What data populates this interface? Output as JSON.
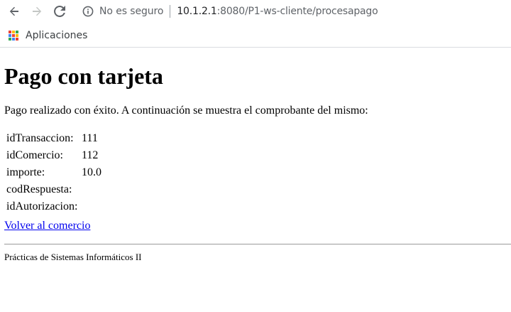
{
  "browser": {
    "security_text": "No es seguro",
    "url_host": "10.1.2.1",
    "url_rest": ":8080/P1-ws-cliente/procesapago",
    "bookmarks": [
      {
        "label": "Aplicaciones",
        "icon": "apps-grid-icon"
      }
    ]
  },
  "page": {
    "title": "Pago con tarjeta",
    "intro": "Pago realizado con éxito. A continuación se muestra el comprobante del mismo:",
    "receipt": [
      {
        "label": "idTransaccion:",
        "value": "111"
      },
      {
        "label": "idComercio:",
        "value": "112"
      },
      {
        "label": "importe:",
        "value": "10.0"
      },
      {
        "label": "codRespuesta:",
        "value": ""
      },
      {
        "label": "idAutorizacion:",
        "value": ""
      }
    ],
    "back_link": "Volver al comercio",
    "footer": "Prácticas de Sistemas Informáticos II"
  },
  "colors": {
    "link": "#0000ee",
    "chrome_icon": "#5f6368",
    "apps_grid": [
      "#ea4335",
      "#fbbc04",
      "#34a853",
      "#4285f4"
    ]
  }
}
